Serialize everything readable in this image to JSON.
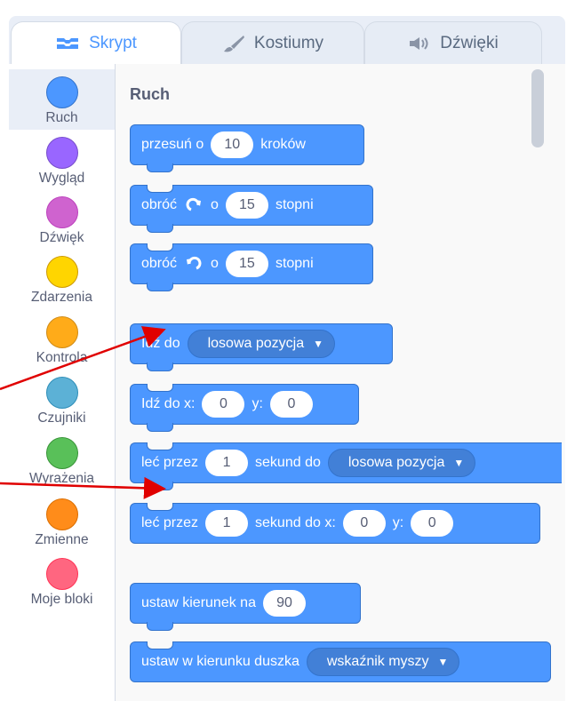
{
  "tabs": [
    {
      "label": "Skrypt",
      "icon": "code-icon",
      "active": true
    },
    {
      "label": "Kostiumy",
      "icon": "paintbrush-icon",
      "active": false
    },
    {
      "label": "Dźwięki",
      "icon": "speaker-icon",
      "active": false
    }
  ],
  "categories": [
    {
      "label": "Ruch",
      "color": "#4c97ff"
    },
    {
      "label": "Wygląd",
      "color": "#9966ff"
    },
    {
      "label": "Dźwięk",
      "color": "#cf63cf"
    },
    {
      "label": "Zdarzenia",
      "color": "#ffd500"
    },
    {
      "label": "Kontrola",
      "color": "#ffab19"
    },
    {
      "label": "Czujniki",
      "color": "#5cb1d6"
    },
    {
      "label": "Wyrażenia",
      "color": "#59c059"
    },
    {
      "label": "Zmienne",
      "color": "#ff8c1a"
    },
    {
      "label": "Moje bloki",
      "color": "#ff6680"
    }
  ],
  "palette": {
    "section_title": "Ruch",
    "blocks": {
      "move": {
        "text1": "przesuń o",
        "value": "10",
        "text2": "kroków"
      },
      "turn_right": {
        "text1": "obróć",
        "text2": "o",
        "value": "15",
        "text3": "stopni"
      },
      "turn_left": {
        "text1": "obróć",
        "text2": "o",
        "value": "15",
        "text3": "stopni"
      },
      "goto": {
        "text1": "Idź do",
        "dropdown": "losowa pozycja"
      },
      "goto_xy": {
        "text1": "Idź do x:",
        "x": "0",
        "text2": "y:",
        "y": "0"
      },
      "glide": {
        "text1": "leć przez",
        "value": "1",
        "text2": "sekund do",
        "dropdown": "losowa pozycja"
      },
      "glide_xy": {
        "text1": "leć przez",
        "value": "1",
        "text2": "sekund do x:",
        "x": "0",
        "text3": "y:",
        "y": "0"
      },
      "point_dir": {
        "text1": "ustaw kierunek na",
        "value": "90"
      },
      "point_towards": {
        "text1": "ustaw w kierunku duszka",
        "dropdown": "wskaźnik myszy"
      }
    }
  },
  "colors": {
    "motion": "#4c97ff",
    "annotation_arrow": "#e00000"
  }
}
